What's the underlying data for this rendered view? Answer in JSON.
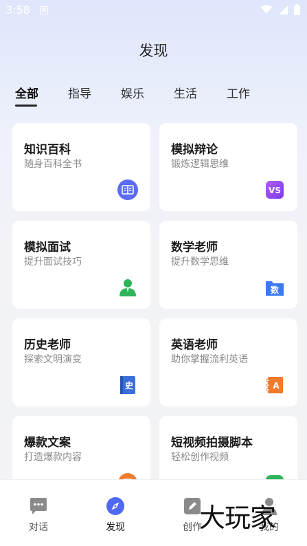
{
  "status_bar": {
    "time": "3:58",
    "notif": "A"
  },
  "page_title": "发现",
  "tabs": [
    {
      "label": "全部",
      "active": true
    },
    {
      "label": "指导"
    },
    {
      "label": "娱乐"
    },
    {
      "label": "生活"
    },
    {
      "label": "工作"
    }
  ],
  "cards": [
    {
      "title": "知识百科",
      "subtitle": "随身百科全书",
      "icon": "book-icon",
      "color": "#5b6cf0"
    },
    {
      "title": "模拟辩论",
      "subtitle": "锻炼逻辑思维",
      "icon": "vs-icon",
      "icon_text": "VS",
      "color": "#9b4df0"
    },
    {
      "title": "模拟面试",
      "subtitle": "提升面试技巧",
      "icon": "person-icon",
      "color": "#2db45a"
    },
    {
      "title": "数学老师",
      "subtitle": "提升数学思维",
      "icon": "math-folder-icon",
      "icon_text": "数",
      "color": "#3a7bf0"
    },
    {
      "title": "历史老师",
      "subtitle": "探索文明演变",
      "icon": "history-book-icon",
      "icon_text": "史",
      "color": "#3a6fd8"
    },
    {
      "title": "英语老师",
      "subtitle": "助你掌握流利英语",
      "icon": "english-notebook-icon",
      "icon_text": "A",
      "color": "#f07a2d"
    },
    {
      "title": "爆款文案",
      "subtitle": "打造爆款内容",
      "icon": "copywriting-icon",
      "color": "#f07a2d"
    },
    {
      "title": "短视频拍摄脚本",
      "subtitle": "轻松创作视频",
      "icon": "video-script-icon",
      "color": "#2db45a"
    }
  ],
  "bottom_nav": [
    {
      "label": "对话",
      "icon": "chat-icon"
    },
    {
      "label": "发现",
      "icon": "compass-icon",
      "active": true
    },
    {
      "label": "创作",
      "icon": "pen-icon"
    },
    {
      "label": "我的",
      "icon": "user-icon"
    }
  ],
  "watermark": "大玩家",
  "colors": {
    "accent": "#4f6af0",
    "text": "#1a1a1a",
    "subtext": "#8a8a8a"
  }
}
